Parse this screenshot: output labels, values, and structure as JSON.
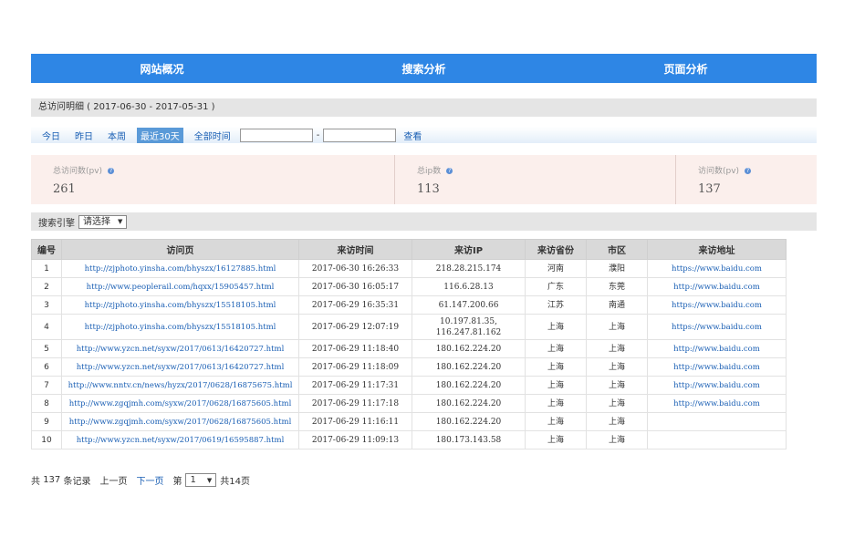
{
  "nav": {
    "tabs": [
      "网站概况",
      "搜索分析",
      "页面分析"
    ]
  },
  "summary": {
    "title": "总访问明细 ( 2017-06-30 - 2017-05-31 )"
  },
  "range": {
    "links": [
      "今日",
      "昨日",
      "本周",
      "最近30天",
      "全部时间"
    ],
    "active_index": 3,
    "start_value": "",
    "end_value": "",
    "separator": "-",
    "query_label": "查看"
  },
  "stats": [
    {
      "label": "总访问数(pv)",
      "value": "261"
    },
    {
      "label": "总ip数",
      "value": "113"
    },
    {
      "label": "访问数(pv)",
      "value": "137"
    }
  ],
  "engine": {
    "label": "搜索引擎",
    "selected": "请选择"
  },
  "table": {
    "headers": [
      "编号",
      "访问页",
      "来访时间",
      "来访IP",
      "来访省份",
      "市区",
      "来访地址"
    ],
    "rows": [
      [
        "1",
        "http://zjphoto.yinsha.com/bhyszx/16127885.html",
        "2017-06-30 16:26:33",
        "218.28.215.174",
        "河南",
        "濮阳",
        "https://www.baidu.com"
      ],
      [
        "2",
        "http://www.peoplerail.com/hqxx/15905457.html",
        "2017-06-30 16:05:17",
        "116.6.28.13",
        "广东",
        "东莞",
        "http://www.baidu.com"
      ],
      [
        "3",
        "http://zjphoto.yinsha.com/bhyszx/15518105.html",
        "2017-06-29 16:35:31",
        "61.147.200.66",
        "江苏",
        "南通",
        "https://www.baidu.com"
      ],
      [
        "4",
        "http://zjphoto.yinsha.com/bhyszx/15518105.html",
        "2017-06-29 12:07:19",
        "10.197.81.35, 116.247.81.162",
        "上海",
        "上海",
        "https://www.baidu.com"
      ],
      [
        "5",
        "http://www.yzcn.net/syxw/2017/0613/16420727.html",
        "2017-06-29 11:18:40",
        "180.162.224.20",
        "上海",
        "上海",
        "http://www.baidu.com"
      ],
      [
        "6",
        "http://www.yzcn.net/syxw/2017/0613/16420727.html",
        "2017-06-29 11:18:09",
        "180.162.224.20",
        "上海",
        "上海",
        "http://www.baidu.com"
      ],
      [
        "7",
        "http://www.nntv.cn/news/hyzx/2017/0628/16875675.html",
        "2017-06-29 11:17:31",
        "180.162.224.20",
        "上海",
        "上海",
        "http://www.baidu.com"
      ],
      [
        "8",
        "http://www.zgqjmh.com/syxw/2017/0628/16875605.html",
        "2017-06-29 11:17:18",
        "180.162.224.20",
        "上海",
        "上海",
        "http://www.baidu.com"
      ],
      [
        "9",
        "http://www.zgqjmh.com/syxw/2017/0628/16875605.html",
        "2017-06-29 11:16:11",
        "180.162.224.20",
        "上海",
        "上海",
        ""
      ],
      [
        "10",
        "http://www.yzcn.net/syxw/2017/0619/16595887.html",
        "2017-06-29 11:09:13",
        "180.173.143.58",
        "上海",
        "上海",
        ""
      ]
    ]
  },
  "pager": {
    "total_prefix": "共",
    "total": "137",
    "total_suffix": "条记录",
    "prev": "上一页",
    "next": "下一页",
    "page_prefix": "第",
    "page": "1",
    "pages": "共14页"
  }
}
